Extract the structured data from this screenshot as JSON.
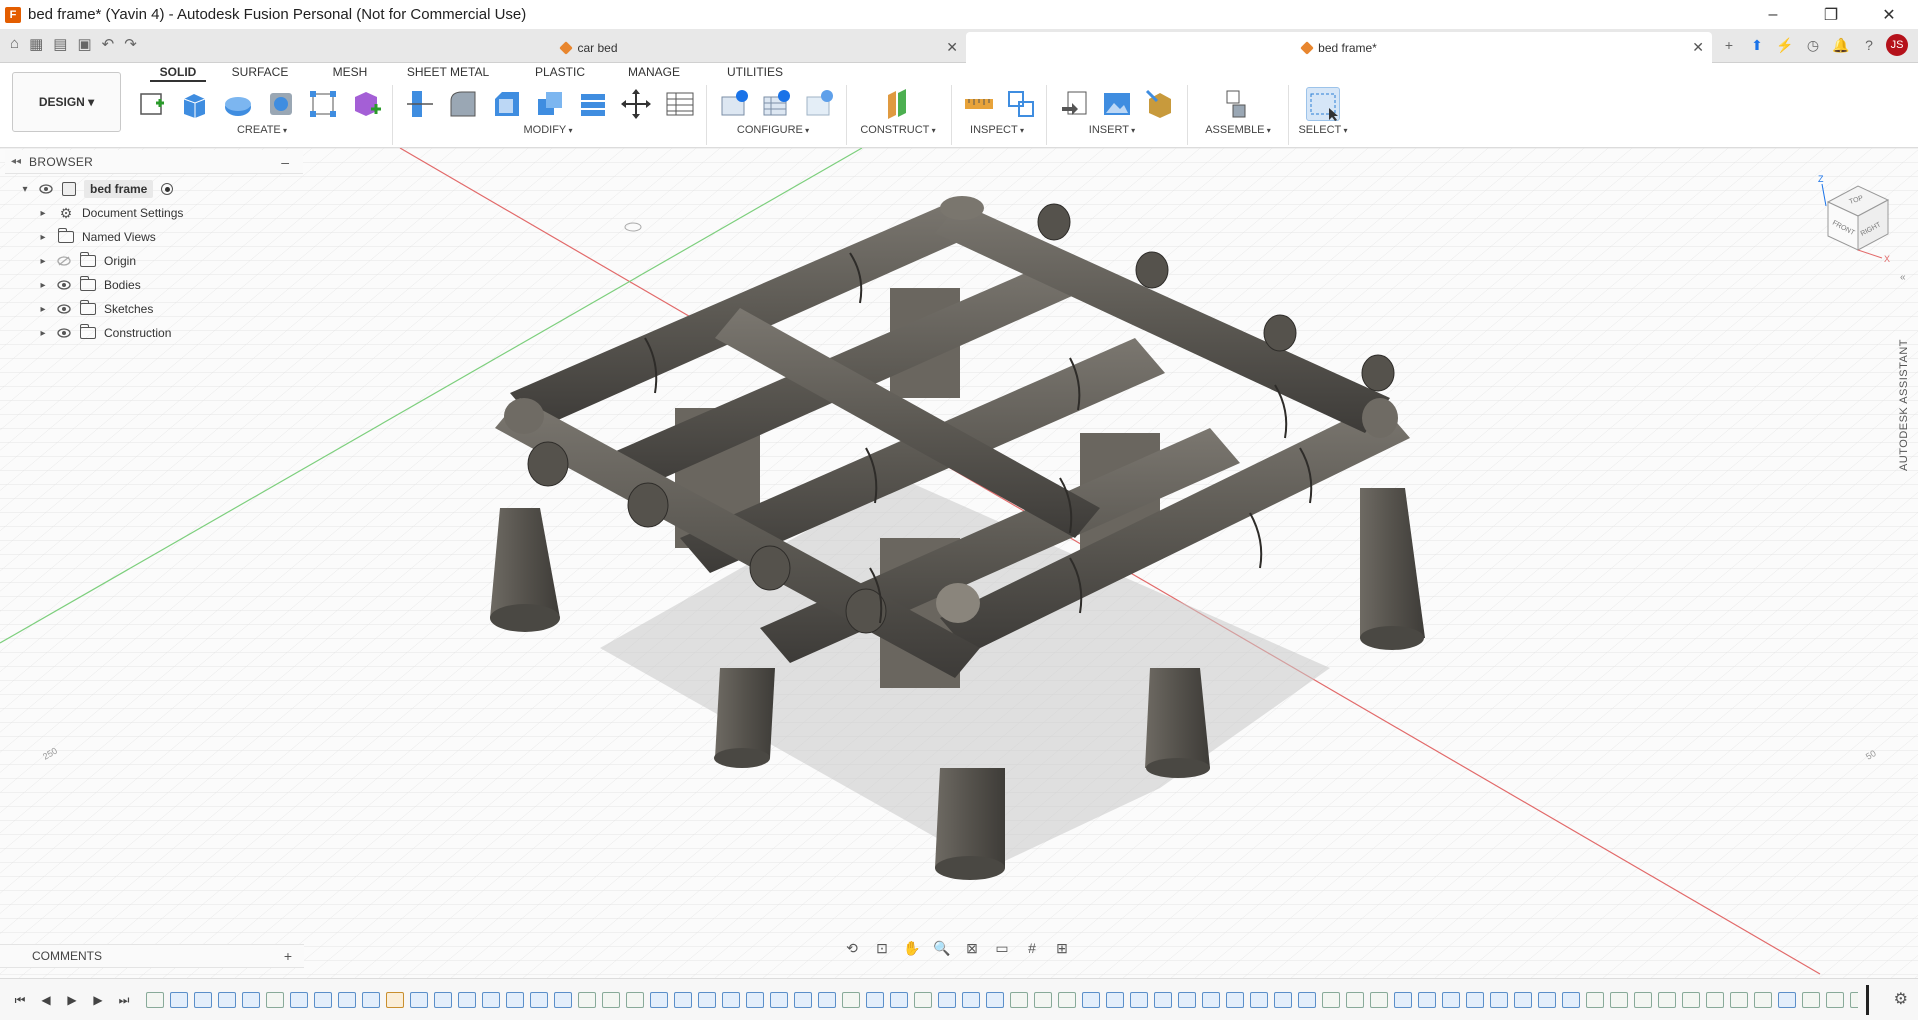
{
  "window": {
    "title": "bed frame* (Yavin 4) - Autodesk Fusion Personal (Not for Commercial Use)",
    "app_icon_letter": "F",
    "controls": [
      "–",
      "❐",
      "✕"
    ]
  },
  "tabs": [
    {
      "label": "car bed",
      "close": "✕"
    },
    {
      "label": "bed frame*",
      "close": "✕"
    }
  ],
  "tabbar_right": {
    "user_initials": "JS"
  },
  "workspace": {
    "label": "DESIGN ▾"
  },
  "ribbon_tabs": [
    "SOLID",
    "SURFACE",
    "MESH",
    "SHEET METAL",
    "PLASTIC",
    "MANAGE",
    "UTILITIES"
  ],
  "ribbon_groups": [
    "CREATE",
    "MODIFY",
    "CONFIGURE",
    "CONSTRUCT",
    "INSPECT",
    "INSERT",
    "ASSEMBLE",
    "SELECT"
  ],
  "browser": {
    "title": "BROWSER",
    "items": [
      {
        "label": "bed frame"
      },
      {
        "label": "Document Settings"
      },
      {
        "label": "Named Views"
      },
      {
        "label": "Origin"
      },
      {
        "label": "Bodies"
      },
      {
        "label": "Sketches"
      },
      {
        "label": "Construction"
      }
    ]
  },
  "comments": {
    "label": "COMMENTS",
    "plus": "+"
  },
  "view_cube": {
    "top": "TOP",
    "front": "FRONT",
    "right": "RIGHT",
    "axis_z": "Z",
    "axis_x": "X"
  },
  "assistant": {
    "label": "AUTODESK ASSISTANT"
  },
  "grid_labels": {
    "left": "250",
    "right": "50"
  },
  "colors": {
    "body": "#5c5953",
    "accent_red": "#e35d00",
    "avatar": "#b5121b",
    "axis_x": "#e26a6a",
    "axis_y": "#7dcf7d"
  }
}
